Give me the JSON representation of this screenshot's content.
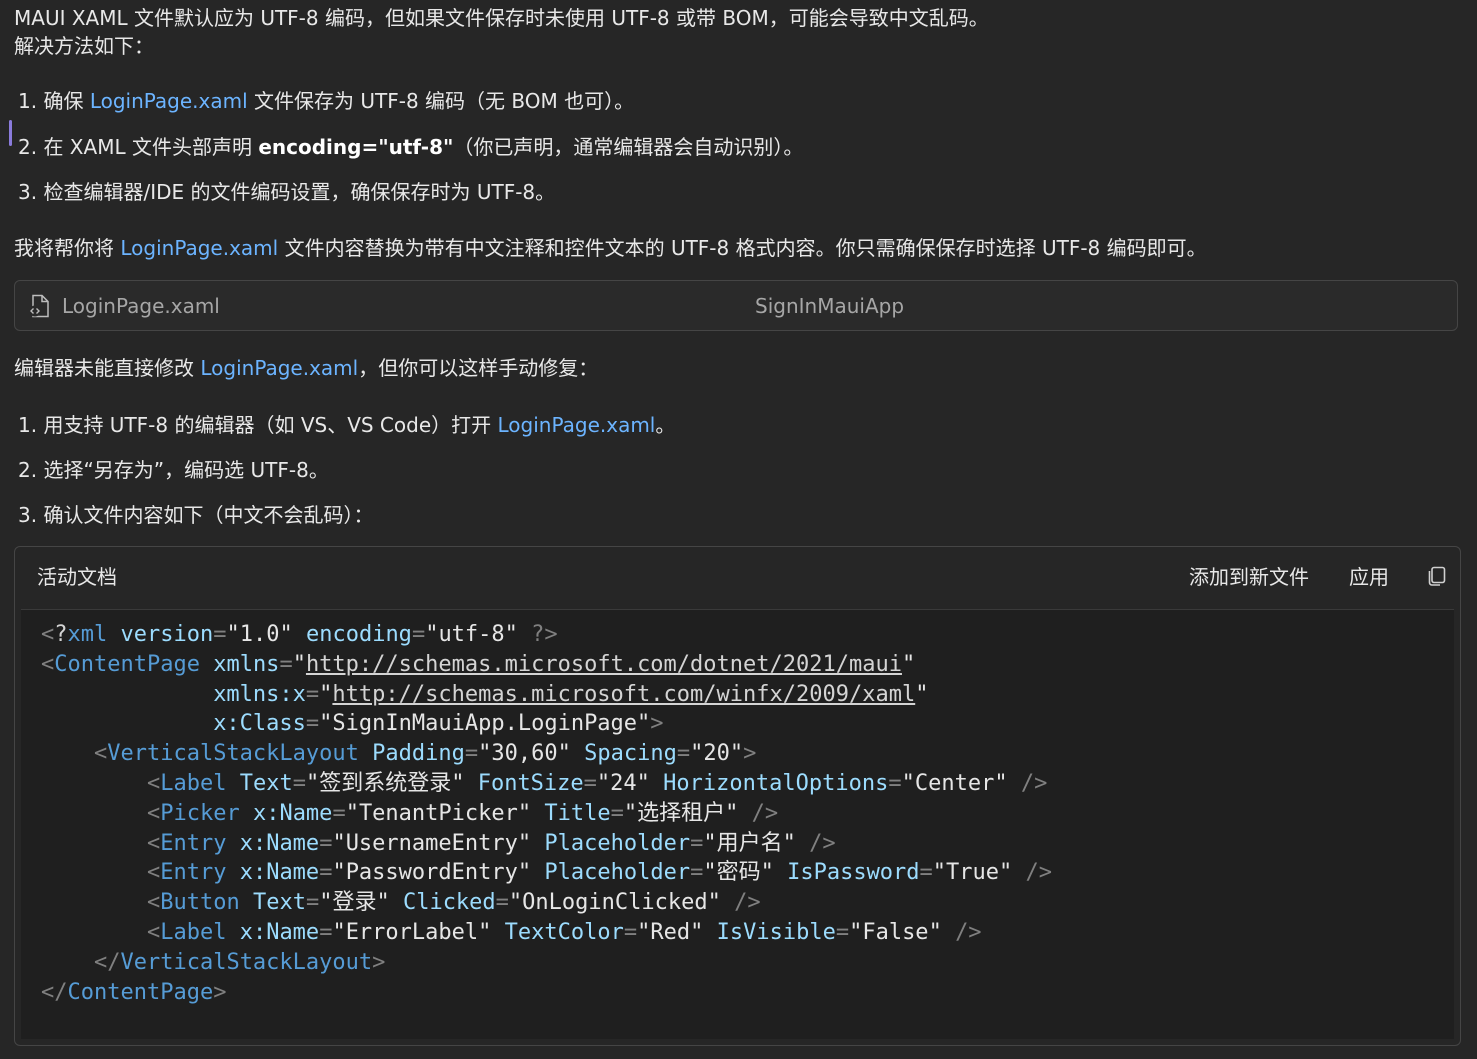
{
  "intro": {
    "line1": "MAUI XAML 文件默认应为 UTF-8 编码，但如果文件保存时未使用 UTF-8 或带 BOM，可能会导致中文乱码。",
    "line2": "解决方法如下："
  },
  "steps1": [
    {
      "num": "1.",
      "pre": " 确保 ",
      "link": "LoginPage.xaml",
      "post": " 文件保存为 UTF-8 编码（无 BOM 也可）。"
    },
    {
      "num": "2.",
      "pre": " 在 XAML 文件头部声明 ",
      "bold": "encoding=\"utf-8\"",
      "post": "（你已声明，通常编辑器会自动识别）。"
    },
    {
      "num": "3.",
      "text": " 检查编辑器/IDE 的文件编码设置，确保保存时为 UTF-8。"
    }
  ],
  "replace_note": {
    "pre": "我将帮你将 ",
    "link": "LoginPage.xaml",
    "post": " 文件内容替换为带有中文注释和控件文本的 UTF-8 格式内容。你只需确保保存时选择 UTF-8 编码即可。"
  },
  "file_card": {
    "icon": "file-code-icon",
    "filename": "LoginPage.xaml",
    "project": "SignInMauiApp"
  },
  "manual_note": {
    "pre": "编辑器未能直接修改 ",
    "link": "LoginPage.xaml",
    "post": "，但你可以这样手动修复："
  },
  "steps2": [
    {
      "num": "1.",
      "pre": " 用支持 UTF-8 的编辑器（如 VS、VS Code）打开 ",
      "link": "LoginPage.xaml",
      "post": "。"
    },
    {
      "num": "2.",
      "text": " 选择“另存为”，编码选 UTF-8。"
    },
    {
      "num": "3.",
      "text": " 确认文件内容如下（中文不会乱码）："
    }
  ],
  "code_card": {
    "title": "活动文档",
    "add_label": "添加到新文件",
    "apply_label": "应用",
    "copy_icon": "copy-icon",
    "lines": [
      "<?xml version=\"1.0\" encoding=\"utf-8\" ?>",
      "<ContentPage xmlns=\"http://schemas.microsoft.com/dotnet/2021/maui\"",
      "             xmlns:x=\"http://schemas.microsoft.com/winfx/2009/xaml\"",
      "             x:Class=\"SignInMauiApp.LoginPage\">",
      "    <VerticalStackLayout Padding=\"30,60\" Spacing=\"20\">",
      "        <Label Text=\"签到系统登录\" FontSize=\"24\" HorizontalOptions=\"Center\" />",
      "        <Picker x:Name=\"TenantPicker\" Title=\"选择租户\" />",
      "        <Entry x:Name=\"UsernameEntry\" Placeholder=\"用户名\" />",
      "        <Entry x:Name=\"PasswordEntry\" Placeholder=\"密码\" IsPassword=\"True\" />",
      "        <Button Text=\"登录\" Clicked=\"OnLoginClicked\" />",
      "        <Label x:Name=\"ErrorLabel\" TextColor=\"Red\" IsVisible=\"False\" />",
      "    </VerticalStackLayout>",
      "</ContentPage>"
    ]
  },
  "colors": {
    "background": "#262626",
    "text": "#e8e8e8",
    "link": "#6cb4ff",
    "tag": "#569cd6",
    "attribute": "#9cdcfe",
    "punctuation": "#808080",
    "marker": "#8a7bdc"
  }
}
